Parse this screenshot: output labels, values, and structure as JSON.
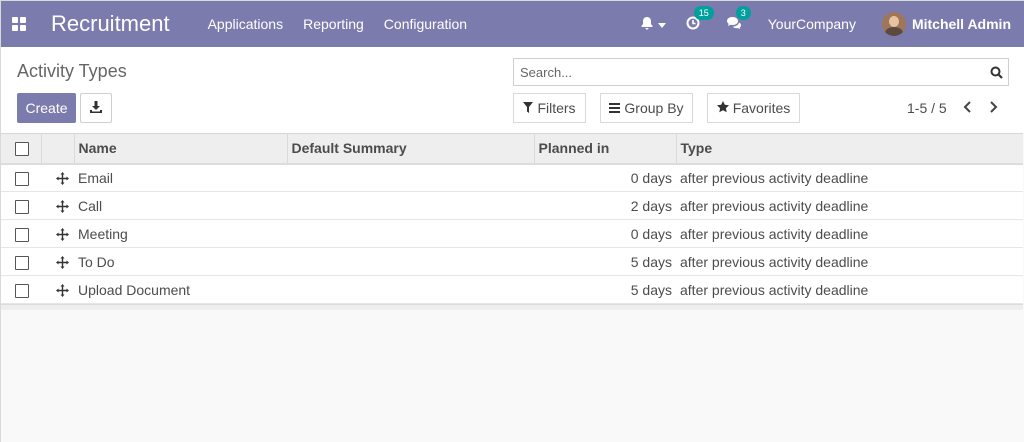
{
  "navbar": {
    "app_name": "Recruitment",
    "menu": [
      "Applications",
      "Reporting",
      "Configuration"
    ],
    "activity_badge": "15",
    "messages_badge": "3",
    "company": "YourCompany",
    "user_name": "Mitchell Admin",
    "color": "#7c7bad"
  },
  "control": {
    "title": "Activity Types",
    "search_placeholder": "Search...",
    "create_label": "Create",
    "filters_label": "Filters",
    "group_by_label": "Group By",
    "favorites_label": "Favorites",
    "pager": "1-5 / 5"
  },
  "table": {
    "columns": [
      "Name",
      "Default Summary",
      "Planned in",
      "Type"
    ],
    "rows": [
      {
        "name": "Email",
        "summary": "",
        "planned": "0 days",
        "type": "after previous activity deadline"
      },
      {
        "name": "Call",
        "summary": "",
        "planned": "2 days",
        "type": "after previous activity deadline"
      },
      {
        "name": "Meeting",
        "summary": "",
        "planned": "0 days",
        "type": "after previous activity deadline"
      },
      {
        "name": "To Do",
        "summary": "",
        "planned": "5 days",
        "type": "after previous activity deadline"
      },
      {
        "name": "Upload Document",
        "summary": "",
        "planned": "5 days",
        "type": "after previous activity deadline"
      }
    ]
  },
  "icons": {
    "apps": "apps-grid-icon",
    "bell": "bell-icon",
    "activity": "clock-icon",
    "messages": "comments-icon",
    "search": "search-icon",
    "download": "download-icon",
    "filter": "filter-icon",
    "group": "list-icon",
    "favorite": "star-icon",
    "drag": "drag-handle-icon"
  }
}
